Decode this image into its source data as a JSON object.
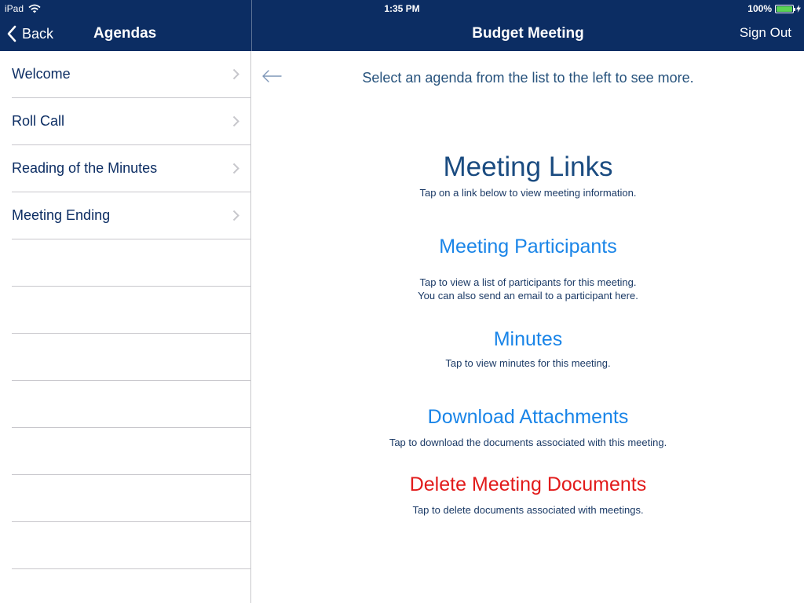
{
  "status_bar": {
    "device": "iPad",
    "time": "1:35 PM",
    "battery": "100%",
    "battery_level": 1.0
  },
  "left_nav": {
    "back_label": "Back",
    "title": "Agendas"
  },
  "main_nav": {
    "title": "Budget Meeting",
    "sign_out_label": "Sign Out"
  },
  "agendas": [
    {
      "label": "Welcome"
    },
    {
      "label": "Roll Call"
    },
    {
      "label": "Reading of the Minutes"
    },
    {
      "label": "Meeting Ending"
    }
  ],
  "main": {
    "hint": "Select an agenda from the list to the left to see more.",
    "section_title": "Meeting Links",
    "section_subtitle": "Tap on a link below to view meeting information.",
    "links": [
      {
        "label": "Meeting Participants",
        "desc_line1": "Tap to view a list of participants for this meeting.",
        "desc_line2": "You can also send an email to a participant here."
      },
      {
        "label": "Minutes",
        "desc_line1": "Tap to view minutes for this meeting."
      },
      {
        "label": "Download Attachments",
        "desc_line1": "Tap to download the documents associated with this meeting."
      },
      {
        "label": "Delete Meeting Documents",
        "desc_line1": "Tap to delete documents associated with meetings."
      }
    ]
  },
  "colors": {
    "nav_background": "#0c2d63",
    "link": "#1a85e8",
    "danger": "#e21b1b",
    "text": "#1b3a66",
    "battery": "#5bd453"
  },
  "icons": [
    "wifi-icon",
    "battery-icon",
    "charging-bolt-icon",
    "back-chevron-icon",
    "row-chevron-icon",
    "left-arrow-icon"
  ]
}
